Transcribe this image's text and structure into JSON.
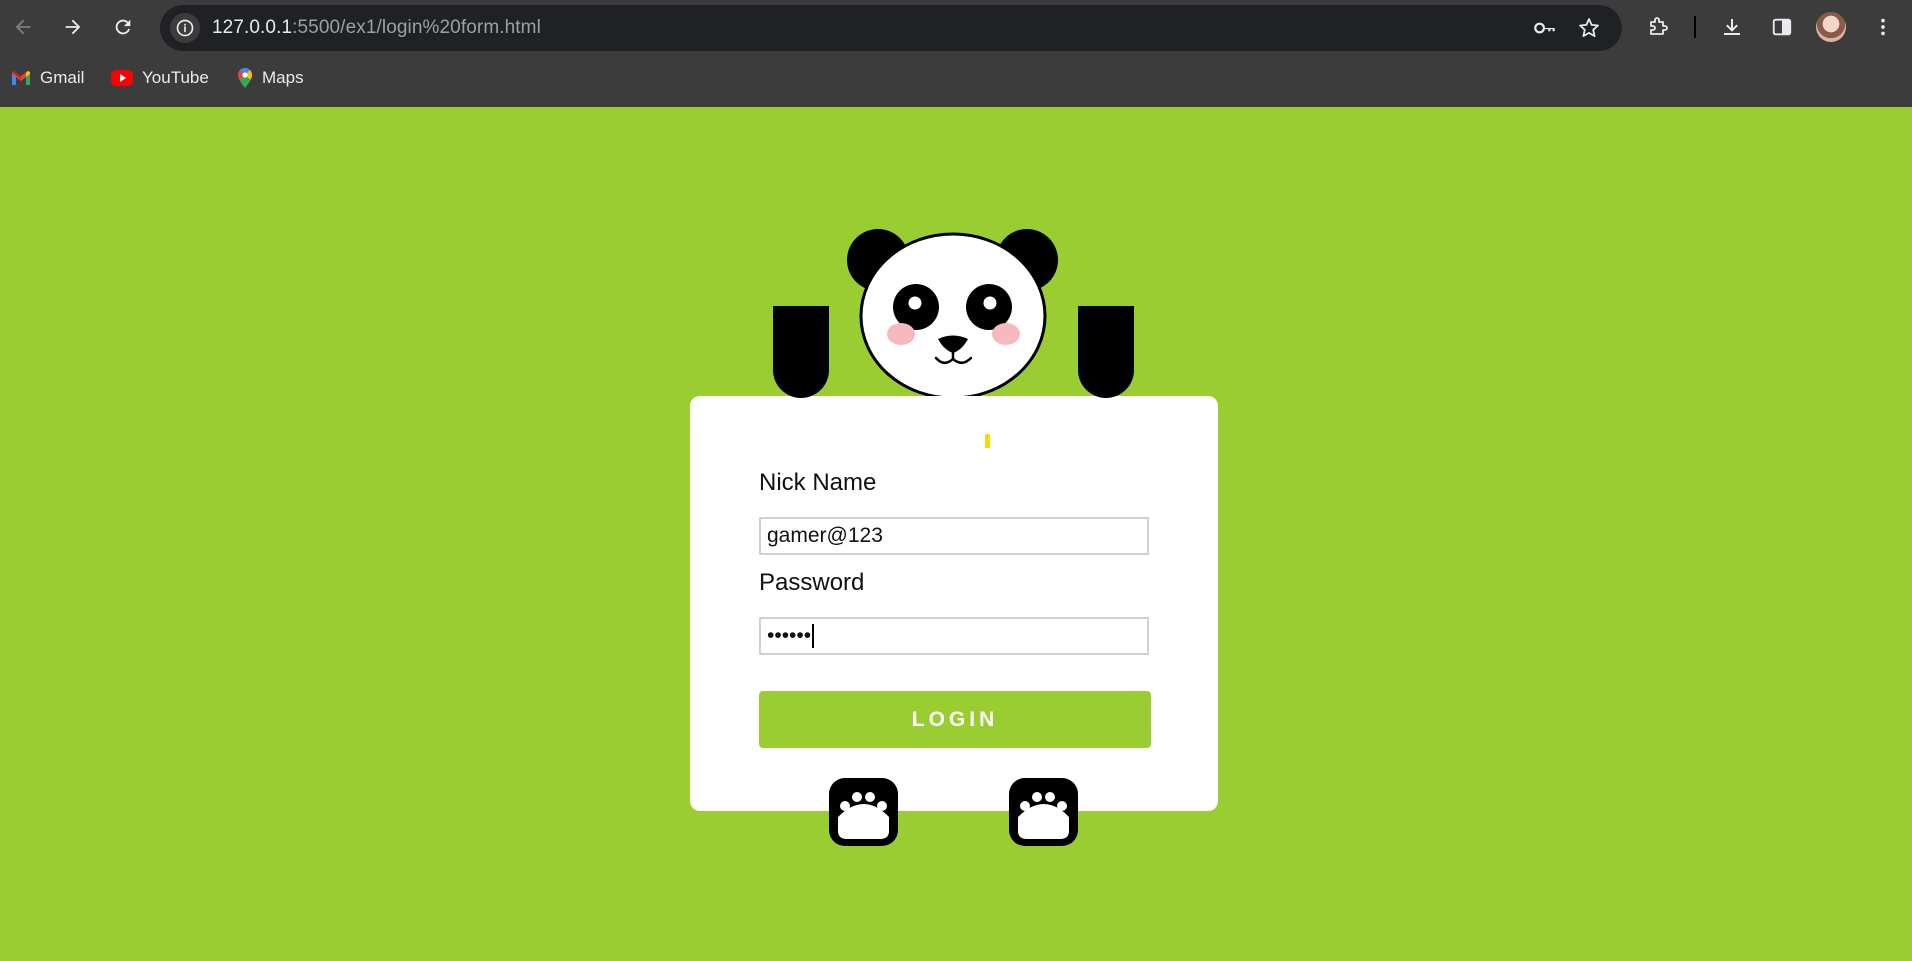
{
  "browser": {
    "url_host": "127.0.0.1",
    "url_rest": ":5500/ex1/login%20form.html",
    "bookmarks": [
      {
        "label": "Gmail",
        "icon": "gmail-icon"
      },
      {
        "label": "YouTube",
        "icon": "youtube-icon"
      },
      {
        "label": "Maps",
        "icon": "maps-icon"
      }
    ]
  },
  "login": {
    "nickname_label": "Nick Name",
    "nickname_value": "gamer@123",
    "password_label": "Password",
    "password_masked": "••••••",
    "button_label": "LOGIN"
  },
  "colors": {
    "background": "#9acd32",
    "card": "#ffffff",
    "button": "#9acd32",
    "panda_black": "#000000",
    "panda_cheek": "#f7b8c0"
  }
}
